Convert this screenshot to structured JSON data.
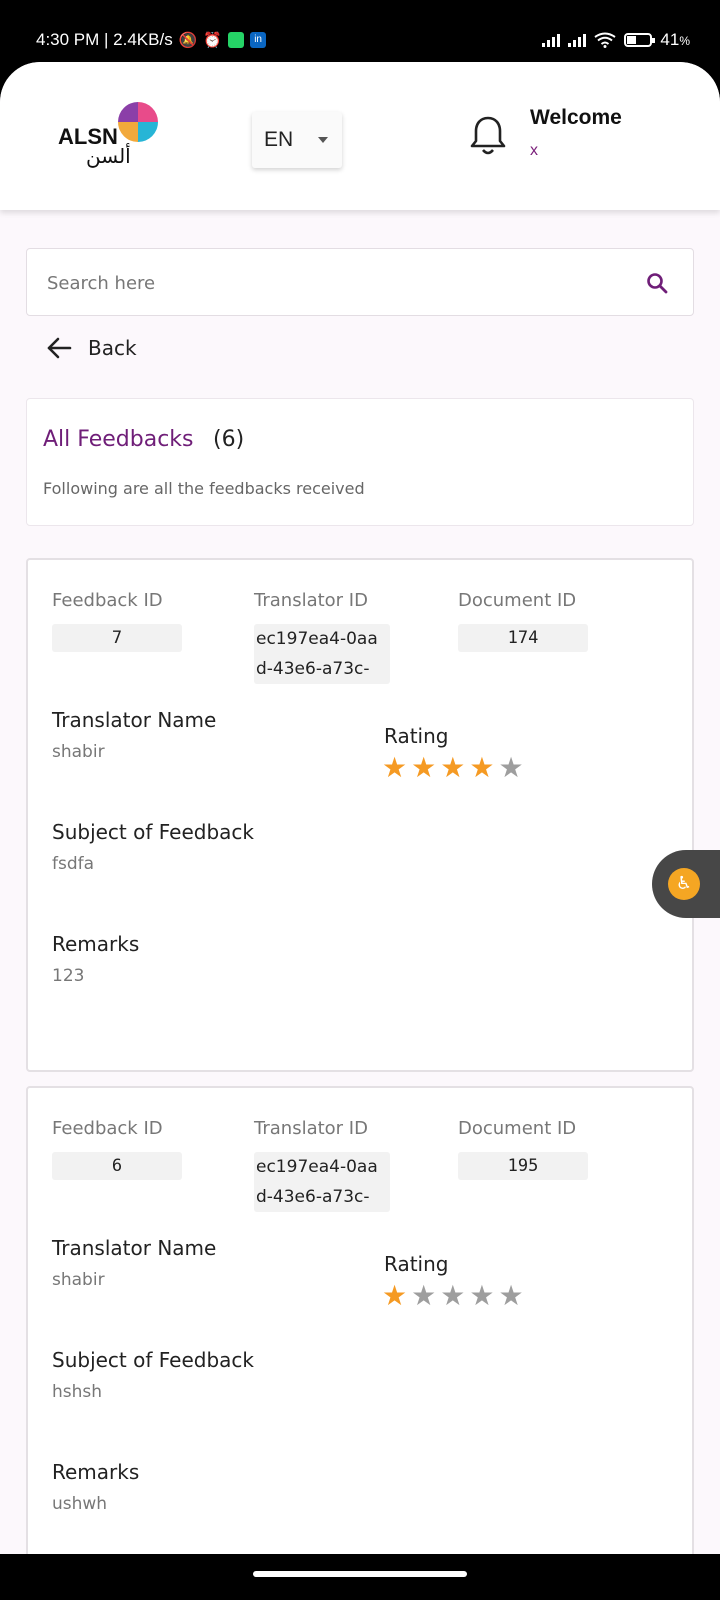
{
  "status_bar": {
    "time_info": "4:30 PM | 2.4KB/s",
    "battery": "41",
    "battery_unit": "%",
    "battery_level": 0.41
  },
  "header": {
    "logo_text": "ALSN",
    "logo_arabic": "ألسن",
    "language": "EN",
    "welcome": "Welcome",
    "user": "x"
  },
  "search": {
    "placeholder": "Search here"
  },
  "back_label": "Back",
  "summary": {
    "title": "All Feedbacks",
    "count": "(6)",
    "subtitle": "Following are all the feedbacks received"
  },
  "labels": {
    "feedback_id": "Feedback ID",
    "translator_id": "Translator ID",
    "document_id": "Document ID",
    "translator_name": "Translator Name",
    "rating": "Rating",
    "subject": "Subject of Feedback",
    "remarks": "Remarks"
  },
  "feedbacks": [
    {
      "feedback_id": "7",
      "translator_id": "ec197ea4-0aad-43e6-a73c-",
      "document_id": "174",
      "translator_name": "shabir",
      "rating": 4,
      "subject": "fsdfa",
      "remarks": "123"
    },
    {
      "feedback_id": "6",
      "translator_id": "ec197ea4-0aad-43e6-a73c-",
      "document_id": "195",
      "translator_name": "shabir",
      "rating": 1,
      "subject": "hshsh",
      "remarks": "ushwh"
    }
  ],
  "colors": {
    "accent": "#6f1e78",
    "star_filled": "#f59a23",
    "star_empty": "#9e9e9e"
  }
}
